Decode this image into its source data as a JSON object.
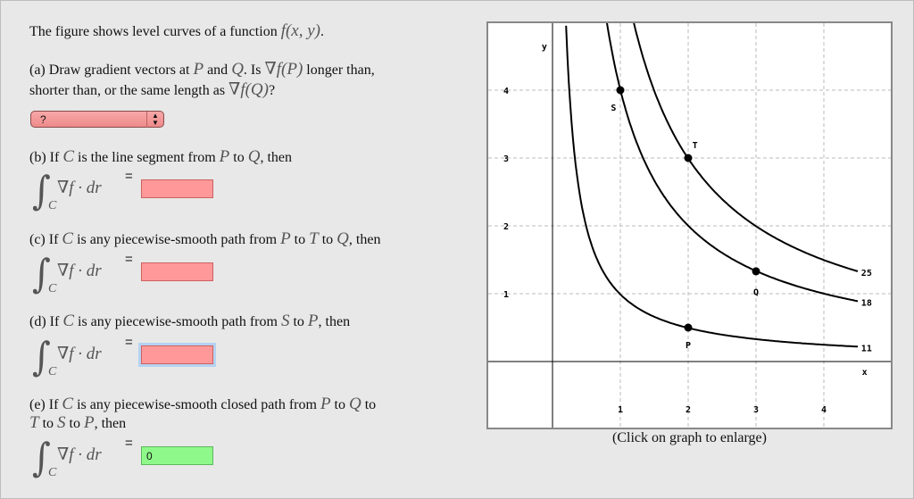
{
  "intro": [
    {
      "t": "The figure shows level curves of a function "
    },
    {
      "t": "f(x, y)",
      "m": true
    },
    {
      "t": "."
    }
  ],
  "qa": {
    "line1": [
      {
        "t": "(a) Draw gradient vectors at "
      },
      {
        "t": "P",
        "m": true
      },
      {
        "t": " and "
      },
      {
        "t": "Q",
        "m": true
      },
      {
        "t": ". Is "
      },
      {
        "t": "∇f(P)",
        "m": true
      },
      {
        "t": " longer than,"
      }
    ],
    "line2": [
      {
        "t": "shorter than, or the same length as "
      },
      {
        "t": "∇f(Q)",
        "m": true
      },
      {
        "t": "?"
      }
    ],
    "select_value": "?"
  },
  "qb": {
    "line1": [
      {
        "t": "(b) If "
      },
      {
        "t": "C",
        "m": true
      },
      {
        "t": " is the line segment from "
      },
      {
        "t": "P",
        "m": true
      },
      {
        "t": " to "
      },
      {
        "t": "Q",
        "m": true
      },
      {
        "t": ", then"
      }
    ],
    "value": ""
  },
  "qc": {
    "line1": [
      {
        "t": "(c) If "
      },
      {
        "t": "C",
        "m": true
      },
      {
        "t": " is any piecewise-smooth path from "
      },
      {
        "t": "P",
        "m": true
      },
      {
        "t": " to "
      },
      {
        "t": "T",
        "m": true
      },
      {
        "t": " to "
      },
      {
        "t": "Q",
        "m": true
      },
      {
        "t": ", then"
      }
    ],
    "value": ""
  },
  "qd": {
    "line1": [
      {
        "t": "(d) If "
      },
      {
        "t": "C",
        "m": true
      },
      {
        "t": " is any piecewise-smooth path from "
      },
      {
        "t": "S",
        "m": true
      },
      {
        "t": " to "
      },
      {
        "t": "P",
        "m": true
      },
      {
        "t": ", then"
      }
    ],
    "value": ""
  },
  "qe": {
    "line1": [
      {
        "t": "(e) If "
      },
      {
        "t": "C",
        "m": true
      },
      {
        "t": " is any piecewise-smooth closed path from "
      },
      {
        "t": "P",
        "m": true
      },
      {
        "t": " to "
      },
      {
        "t": "Q",
        "m": true
      },
      {
        "t": " to"
      }
    ],
    "line2": [
      {
        "t": "T",
        "m": true
      },
      {
        "t": " to "
      },
      {
        "t": "S",
        "m": true
      },
      {
        "t": " to "
      },
      {
        "t": "P",
        "m": true
      },
      {
        "t": ", then"
      }
    ],
    "value": "0"
  },
  "integral": {
    "sign": "∫",
    "sub": "C",
    "expr": "∇f · dr⃗",
    "eq": "="
  },
  "colors": {
    "wrong": "#ff9999",
    "correct": "#8ef98a",
    "focus": "#b5d3f2"
  },
  "caption": "(Click on graph to enlarge)",
  "chart_data": {
    "type": "line",
    "xlabel": "x",
    "ylabel": "y",
    "xlim": [
      -1,
      5
    ],
    "ylim": [
      -1,
      5
    ],
    "xticks": [
      "1",
      "2",
      "3",
      "4"
    ],
    "yticks": [
      "1",
      "2",
      "3",
      "4"
    ],
    "grid": true,
    "series": [
      {
        "name": "11",
        "points": [
          [
            0.2,
            5
          ],
          [
            0.25,
            4
          ],
          [
            0.33,
            3
          ],
          [
            0.5,
            2
          ],
          [
            0.75,
            1.33
          ],
          [
            1,
            1
          ],
          [
            1.5,
            0.67
          ],
          [
            2,
            0.5
          ],
          [
            3,
            0.33
          ],
          [
            4,
            0.25
          ],
          [
            4.5,
            0.22
          ]
        ]
      },
      {
        "name": "18",
        "points": [
          [
            0.8,
            5
          ],
          [
            1,
            4
          ],
          [
            1.33,
            3
          ],
          [
            1.6,
            2.5
          ],
          [
            2,
            2
          ],
          [
            2.5,
            1.6
          ],
          [
            3,
            1.33
          ],
          [
            3.5,
            1.14
          ],
          [
            4,
            1
          ],
          [
            4.5,
            0.89
          ]
        ]
      },
      {
        "name": "25",
        "points": [
          [
            1.2,
            5
          ],
          [
            1.5,
            4
          ],
          [
            1.75,
            3.43
          ],
          [
            2,
            3
          ],
          [
            2.5,
            2.4
          ],
          [
            3,
            2
          ],
          [
            3.5,
            1.71
          ],
          [
            4,
            1.5
          ],
          [
            4.5,
            1.33
          ]
        ]
      }
    ],
    "points": [
      {
        "label": "S",
        "x": 1,
        "y": 4
      },
      {
        "label": "T",
        "x": 2,
        "y": 3
      },
      {
        "label": "Q",
        "x": 3,
        "y": 1.33
      },
      {
        "label": "P",
        "x": 2,
        "y": 0.5
      }
    ]
  }
}
